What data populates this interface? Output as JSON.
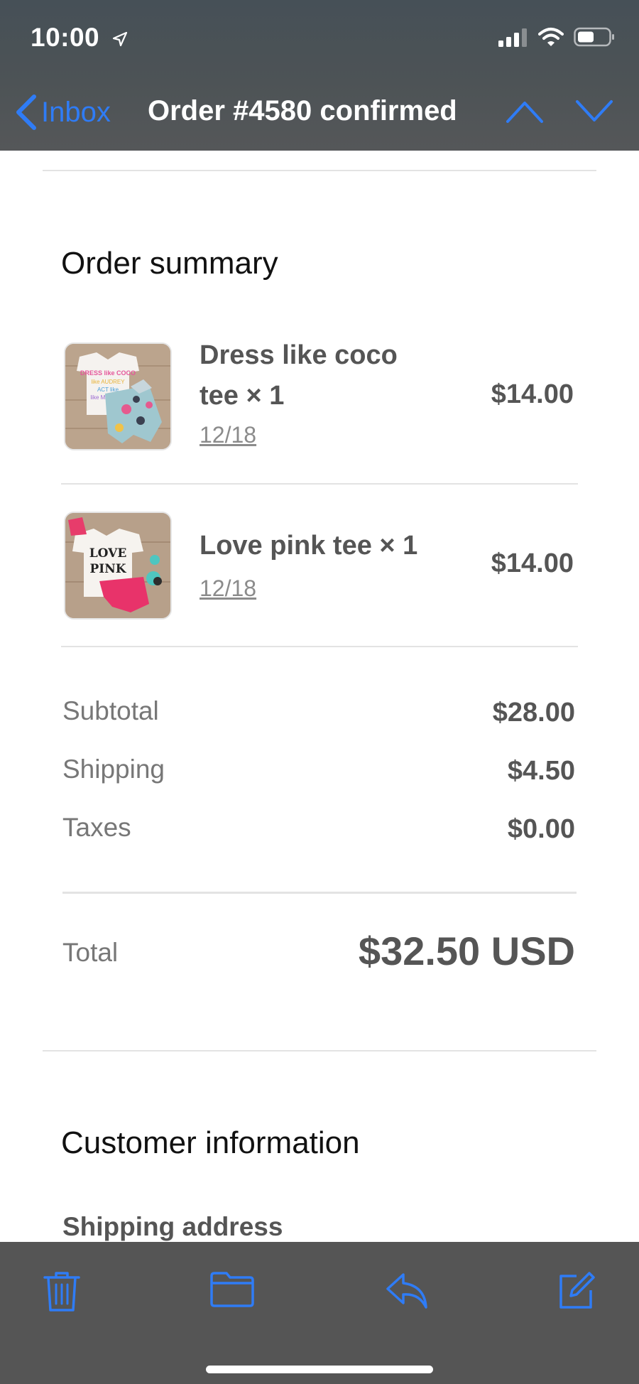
{
  "status_bar": {
    "time": "10:00"
  },
  "nav": {
    "back_label": "Inbox",
    "title": "Order #4580 confirmed"
  },
  "order_summary": {
    "heading": "Order summary",
    "items": [
      {
        "name_line1": "Dress like coco",
        "name_line2": "tee × 1",
        "variant": "12/18",
        "price": "$14.00",
        "thumb_text": "DRESS like COCO"
      },
      {
        "name_line1": "Love pink tee × 1",
        "variant": "12/18",
        "price": "$14.00",
        "thumb_text": "LOVE PINK"
      }
    ],
    "subtotal_label": "Subtotal",
    "subtotal_value": "$28.00",
    "shipping_label": "Shipping",
    "shipping_value": "$4.50",
    "taxes_label": "Taxes",
    "taxes_value": "$0.00",
    "total_label": "Total",
    "total_value": "$32.50 USD"
  },
  "customer_info": {
    "heading": "Customer information",
    "shipping_address_label": "Shipping address"
  },
  "toolbar": {
    "icons": [
      "trash-icon",
      "folder-icon",
      "reply-icon",
      "compose-icon"
    ]
  },
  "colors": {
    "accent": "#2f7cf6",
    "toolbar": "#555555",
    "header": "#4d5356"
  }
}
